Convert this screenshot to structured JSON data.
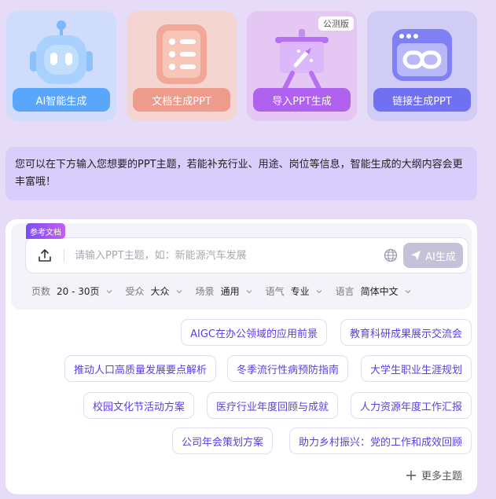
{
  "cards": [
    {
      "label": "AI智能生成",
      "color": "#5aa6fb"
    },
    {
      "label": "文档生成PPT",
      "color": "#ee9b8b"
    },
    {
      "label": "导入PPT生成",
      "color": "#b061f0",
      "badge": "公测版"
    },
    {
      "label": "链接生成PPT",
      "color": "#6f70f2"
    }
  ],
  "tip": "您可以在下方输入您想要的PPT主题，若能补充行业、用途、岗位等信息，智能生成的大纲内容会更丰富哦！",
  "input": {
    "ref_badge": "参考文档",
    "value": "",
    "placeholder": "请输入PPT主题，如：新能源汽车发展",
    "generate_label": "AI生成"
  },
  "options": [
    {
      "key": "页数",
      "value": "20 - 30页"
    },
    {
      "key": "受众",
      "value": "大众"
    },
    {
      "key": "场景",
      "value": "通用"
    },
    {
      "key": "语气",
      "value": "专业"
    },
    {
      "key": "语言",
      "value": "简体中文"
    }
  ],
  "topics": [
    "AIGC在办公领域的应用前景",
    "教育科研成果展示交流会",
    "推动人口高质量发展要点解析",
    "冬季流行性病预防指南",
    "大学生职业生涯规划",
    "校园文化节活动方案",
    "医疗行业年度回顾与成就",
    "人力资源年度工作汇报",
    "公司年会策划方案",
    "助力乡村振兴：党的工作和成效回顾"
  ],
  "more_label": "更多主题",
  "icons": {
    "card_ai": "robot-icon",
    "card_doc": "document-list-icon",
    "card_import": "presentation-board-icon",
    "card_link": "browser-link-icon",
    "upload": "upload-icon",
    "web": "globe-icon",
    "generate": "send-icon",
    "more": "plus-icon"
  }
}
